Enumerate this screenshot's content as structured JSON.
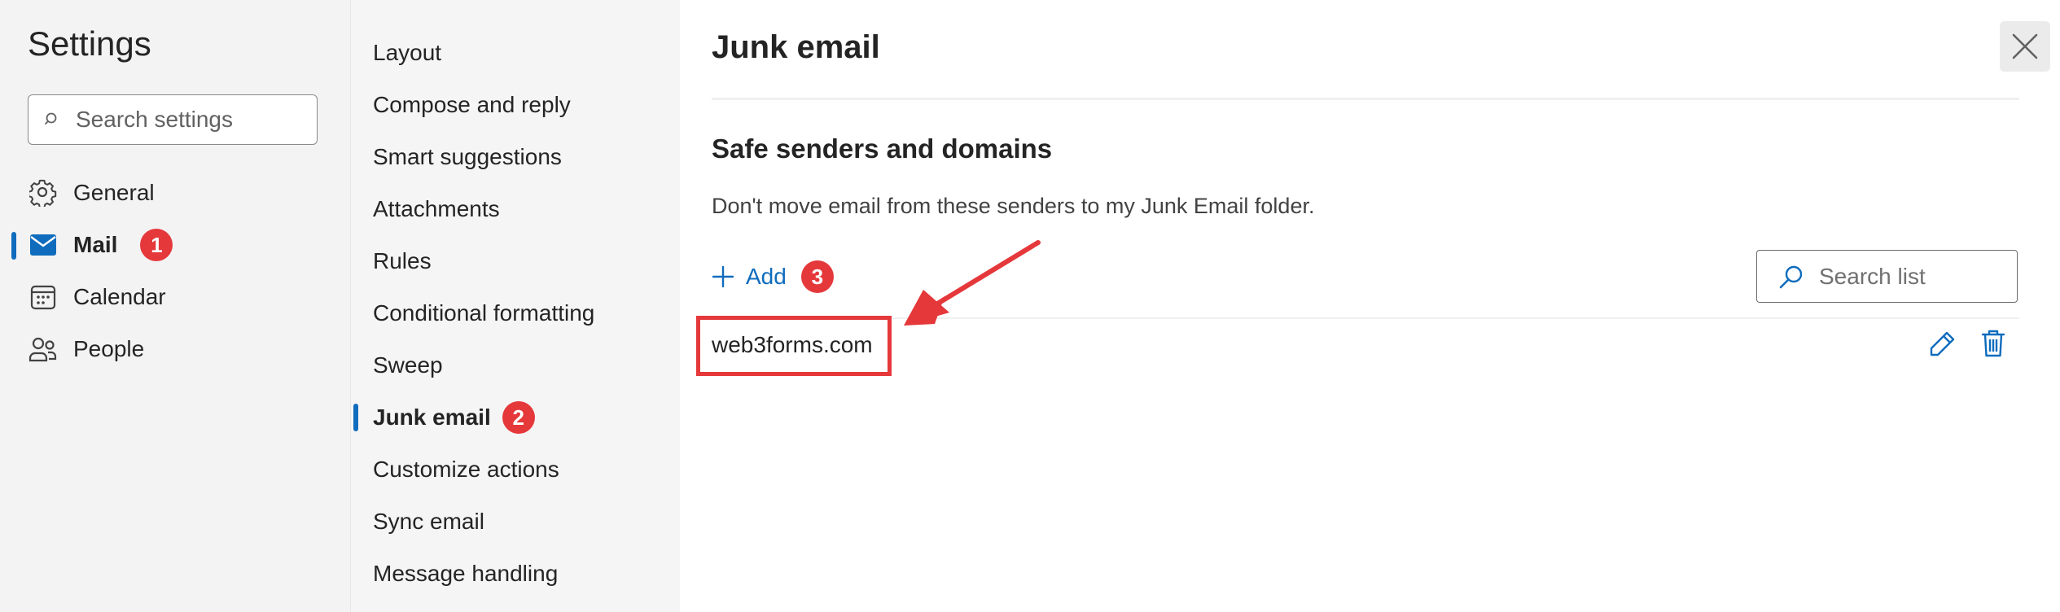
{
  "sidebar": {
    "title": "Settings",
    "search_placeholder": "Search settings",
    "items": [
      {
        "label": "General",
        "icon": "gear-icon"
      },
      {
        "label": "Mail",
        "icon": "mail-icon",
        "selected": true,
        "badge": "1"
      },
      {
        "label": "Calendar",
        "icon": "calendar-icon"
      },
      {
        "label": "People",
        "icon": "people-icon"
      }
    ]
  },
  "subnav": {
    "items": [
      {
        "label": "Layout"
      },
      {
        "label": "Compose and reply"
      },
      {
        "label": "Smart suggestions"
      },
      {
        "label": "Attachments"
      },
      {
        "label": "Rules"
      },
      {
        "label": "Conditional formatting"
      },
      {
        "label": "Sweep"
      },
      {
        "label": "Junk email",
        "selected": true,
        "badge": "2"
      },
      {
        "label": "Customize actions"
      },
      {
        "label": "Sync email"
      },
      {
        "label": "Message handling"
      }
    ]
  },
  "main": {
    "title": "Junk email",
    "section_title": "Safe senders and domains",
    "section_desc": "Don't move email from these senders to my Junk Email folder.",
    "add_label": "Add",
    "add_badge": "3",
    "search_list_placeholder": "Search list",
    "list": [
      {
        "value": "web3forms.com"
      }
    ]
  },
  "colors": {
    "accent": "#0f6cbd",
    "annotation_red": "#e5383b"
  }
}
